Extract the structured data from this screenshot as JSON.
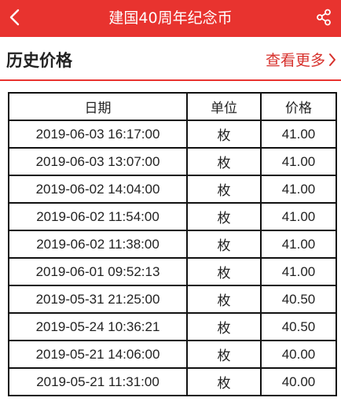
{
  "header": {
    "title": "建国40周年纪念币",
    "back_icon": "chevron-left-icon",
    "share_icon": "share-icon",
    "bg_color": "#e8332f"
  },
  "section": {
    "title": "历史价格",
    "more_label": "查看更多",
    "more_icon": "chevron-right-icon",
    "accent_color": "#d7312c"
  },
  "table": {
    "headers": [
      "日期",
      "单位",
      "价格"
    ],
    "rows": [
      {
        "date": "2019-06-03 16:17:00",
        "unit": "枚",
        "price": "41.00"
      },
      {
        "date": "2019-06-03 13:07:00",
        "unit": "枚",
        "price": "41.00"
      },
      {
        "date": "2019-06-02 14:04:00",
        "unit": "枚",
        "price": "41.00"
      },
      {
        "date": "2019-06-02 11:54:00",
        "unit": "枚",
        "price": "41.00"
      },
      {
        "date": "2019-06-02 11:38:00",
        "unit": "枚",
        "price": "41.00"
      },
      {
        "date": "2019-06-01 09:52:13",
        "unit": "枚",
        "price": "41.00"
      },
      {
        "date": "2019-05-31 21:25:00",
        "unit": "枚",
        "price": "40.50"
      },
      {
        "date": "2019-05-24 10:36:21",
        "unit": "枚",
        "price": "40.50"
      },
      {
        "date": "2019-05-21 14:06:00",
        "unit": "枚",
        "price": "40.00"
      },
      {
        "date": "2019-05-21 11:31:00",
        "unit": "枚",
        "price": "40.00"
      }
    ]
  }
}
